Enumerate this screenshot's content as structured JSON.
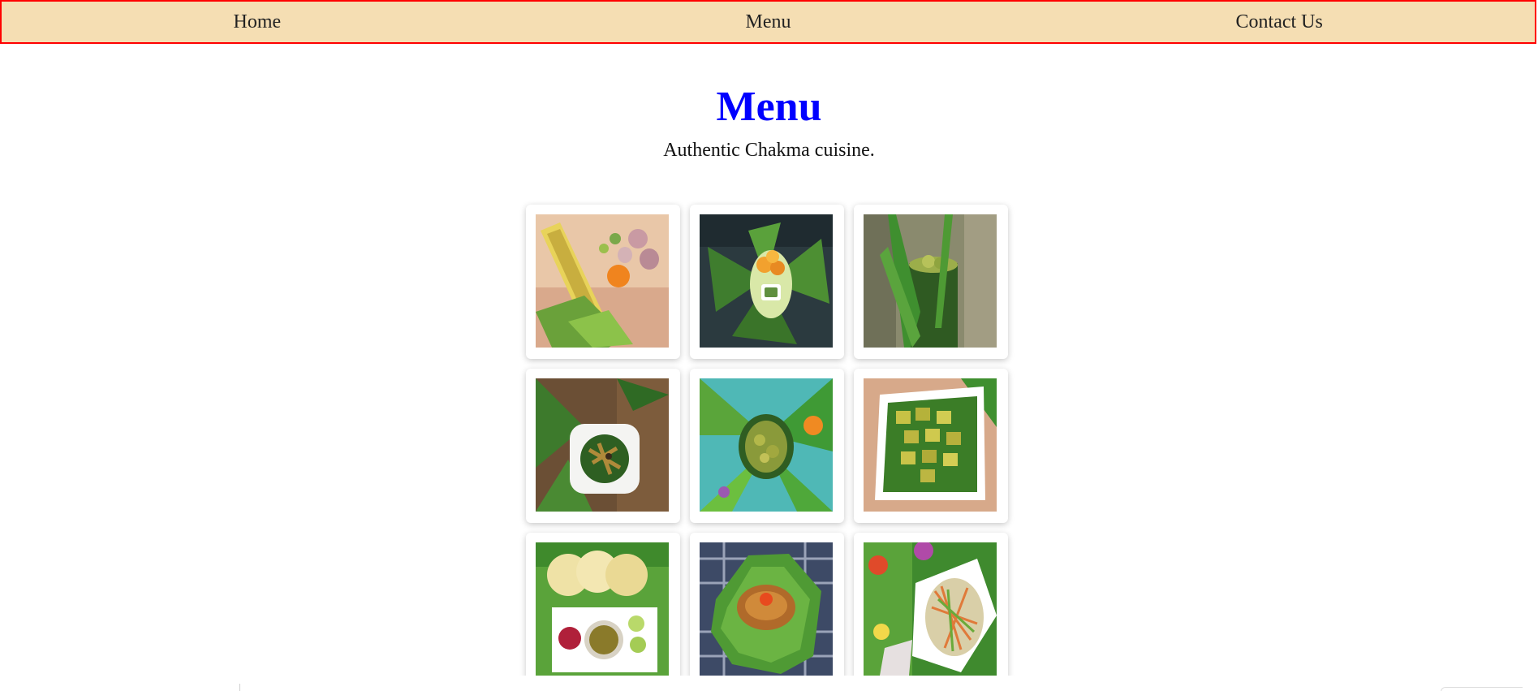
{
  "nav": {
    "items": [
      {
        "label": "Home"
      },
      {
        "label": "Menu"
      },
      {
        "label": "Contact Us"
      }
    ]
  },
  "hero": {
    "title": "Menu",
    "subtitle": "Authentic Chakma cuisine."
  },
  "colors": {
    "nav_background": "#f5deb3",
    "nav_border": "#ff0000",
    "title": "#0000ff"
  },
  "dishes": [
    {
      "icon": "bamboo-shoot-spices-photo"
    },
    {
      "icon": "fried-bites-on-leaves-photo"
    },
    {
      "icon": "bamboo-tube-dish-photo"
    },
    {
      "icon": "bamboo-shoot-bowl-photo"
    },
    {
      "icon": "curry-on-banana-leaf-photo"
    },
    {
      "icon": "tofu-cubes-bowl-photo"
    },
    {
      "icon": "papad-and-soup-photo"
    },
    {
      "icon": "fish-on-leaves-photo"
    },
    {
      "icon": "noodle-salad-photo"
    }
  ]
}
